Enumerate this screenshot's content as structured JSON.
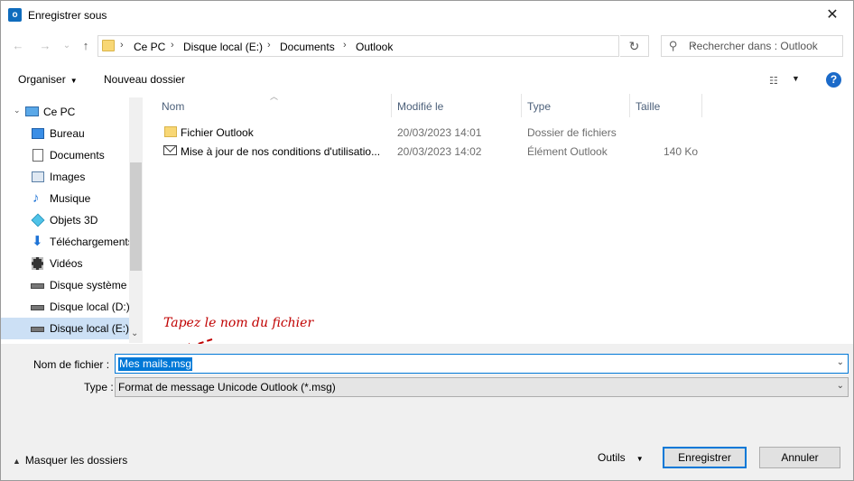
{
  "window": {
    "title": "Enregistrer sous",
    "app_icon": "outlook-icon",
    "close_glyph": "✕"
  },
  "nav": {
    "back_glyph": "←",
    "forward_glyph": "→",
    "recent_glyph": "⌄",
    "up_glyph": "↑",
    "breadcrumb": [
      "Ce PC",
      "Disque local (E:)",
      "Documents",
      "Outlook"
    ],
    "separator_glyph": "›",
    "refresh_glyph": "↻",
    "search_placeholder": "Rechercher dans : Outlook"
  },
  "toolbar": {
    "organize_label": "Organiser",
    "new_folder_label": "Nouveau dossier",
    "help_glyph": "?"
  },
  "sidebar": {
    "items": [
      {
        "label": "Ce PC",
        "icon": "computer-icon"
      },
      {
        "label": "Bureau",
        "icon": "desktop-icon"
      },
      {
        "label": "Documents",
        "icon": "documents-icon"
      },
      {
        "label": "Images",
        "icon": "images-icon"
      },
      {
        "label": "Musique",
        "icon": "music-icon"
      },
      {
        "label": "Objets 3D",
        "icon": "objects-3d-icon"
      },
      {
        "label": "Téléchargements",
        "icon": "downloads-icon"
      },
      {
        "label": "Vidéos",
        "icon": "videos-icon"
      },
      {
        "label": "Disque système",
        "icon": "drive-icon"
      },
      {
        "label": "Disque local (D:)",
        "icon": "drive-icon"
      },
      {
        "label": "Disque local (E:)",
        "icon": "drive-icon",
        "selected": true
      }
    ]
  },
  "files": {
    "columns": [
      "Nom",
      "Modifié le",
      "Type",
      "Taille"
    ],
    "rows": [
      {
        "name": "Fichier Outlook",
        "modified": "20/03/2023 14:01",
        "type": "Dossier de fichiers",
        "size": "",
        "icon": "folder-icon"
      },
      {
        "name": "Mise à jour de nos conditions d'utilisatio...",
        "modified": "20/03/2023 14:02",
        "type": "Élément Outlook",
        "size": "140 Ko",
        "icon": "mail-icon"
      }
    ]
  },
  "annotation": {
    "text": "Tapez le nom du fichier",
    "color": "#c00000"
  },
  "form": {
    "filename_label": "Nom de fichier :",
    "filename_value": "Mes mails.msg",
    "type_label": "Type :",
    "type_value": "Format de message Unicode Outlook (*.msg)",
    "hide_folders_label": "Masquer les dossiers",
    "tools_label": "Outils",
    "save_label": "Enregistrer",
    "cancel_label": "Annuler"
  },
  "colors": {
    "accent": "#0078d7",
    "selection": "#cce0f5",
    "column_header": "#4c607a"
  }
}
